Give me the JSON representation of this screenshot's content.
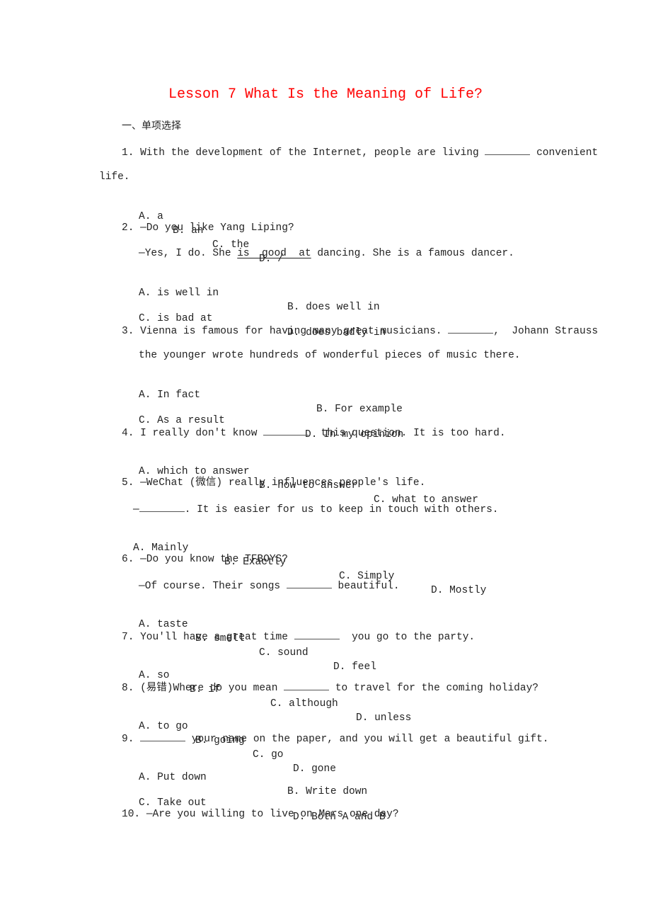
{
  "document": {
    "title": "Lesson 7 What Is the Meaning of Life?",
    "section_heading": "一、单项选择",
    "questions": [
      {
        "number": "1.",
        "lines": [
          "With the development of the Internet, people are living",
          "convenient",
          "life."
        ],
        "options": [
          "A. a",
          "B. an",
          "C. the",
          "D. /"
        ]
      },
      {
        "number": "2.",
        "lines": [
          "—Do you like Yang Liping?",
          "—Yes, I do. She",
          "is  good  at",
          "dancing. She is a famous dancer."
        ],
        "options": [
          "A. is well in",
          "B. does well in",
          "C. is bad at",
          "D. does badly in"
        ]
      },
      {
        "number": "3.",
        "lines": [
          "Vienna is famous for having many great musicians.",
          ",  Johann Strauss",
          "the younger wrote hundreds of wonderful pieces of music there."
        ],
        "options": [
          "A. In fact",
          "B. For example",
          "C. As a result",
          "D. In my opinion"
        ]
      },
      {
        "number": "4.",
        "lines": [
          "I really don't know",
          "this question. It is too hard."
        ],
        "options": [
          "A. which to answer",
          "B. how to answer",
          "C. what to answer"
        ]
      },
      {
        "number": "5.",
        "lines": [
          "—WeChat (微信) really influences people's life.",
          "—",
          ". It is easier for us to keep in touch with others."
        ],
        "options": [
          "A. Mainly",
          "B. Exactly",
          "C. Simply",
          "D. Mostly"
        ]
      },
      {
        "number": "6.",
        "lines": [
          "—Do you know the TFBOYS?",
          "—Of course. Their songs",
          "beautiful."
        ],
        "options": [
          "A. taste",
          "B. smell",
          "C. sound",
          "D. feel"
        ]
      },
      {
        "number": "7.",
        "lines": [
          "You'll have a great time",
          "you go to the party."
        ],
        "options": [
          "A. so",
          "B. if",
          "C. although",
          "D. unless"
        ]
      },
      {
        "number": "8.",
        "lines": [
          "(易错)Where do you mean",
          "to travel for the coming holiday?"
        ],
        "options": [
          "A. to go",
          "B. going",
          "C. go",
          "D. gone"
        ]
      },
      {
        "number": "9.",
        "lines": [
          "your name on the paper, and you will get a beautiful gift."
        ],
        "options": [
          "A. Put down",
          "B. Write down",
          "C. Take out",
          "D. Both A and B"
        ]
      },
      {
        "number": "10.",
        "lines": [
          "—Are you willing to live on Mars one day?"
        ],
        "options": []
      }
    ]
  }
}
